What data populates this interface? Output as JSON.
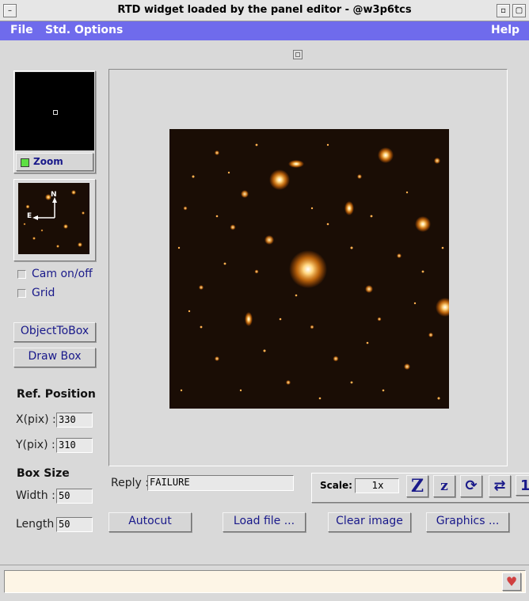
{
  "window": {
    "title": "RTD widget loaded by the panel editor - @w3p6tcs"
  },
  "menu": {
    "file": "File",
    "std_options": "Std. Options",
    "help": "Help"
  },
  "panner": {
    "zoom_label": "Zoom"
  },
  "compass": {
    "north": "N",
    "east": "E"
  },
  "options": {
    "cam_label": "Cam on/off",
    "grid_label": "Grid"
  },
  "buttons": {
    "object_to_box": "ObjectToBox",
    "draw_box": "Draw Box",
    "autocut": "Autocut",
    "load_file": "Load file ...",
    "clear_image": "Clear image",
    "graphics": "Graphics ..."
  },
  "ref_position": {
    "heading": "Ref. Position",
    "x_label": "X(pix) :",
    "x_value": "330",
    "y_label": "Y(pix) :",
    "y_value": "310"
  },
  "box_size": {
    "heading": "Box Size",
    "width_label": "Width :",
    "width_value": "50",
    "length_label": "Length :",
    "length_value": "50"
  },
  "reply": {
    "label": "Reply :",
    "value": "FAILURE"
  },
  "scale": {
    "label": "Scale:",
    "value": "1x",
    "zoom_in": "Z",
    "zoom_out": "z",
    "rotate": "⟳",
    "flip": "⇄",
    "one": "1"
  },
  "status": {
    "value": ""
  },
  "colors": {
    "menubar": "#6f6bec",
    "label_text": "#1a1a8a",
    "zoom_indicator": "#5ee043",
    "image_bg": "#1a0d05"
  }
}
